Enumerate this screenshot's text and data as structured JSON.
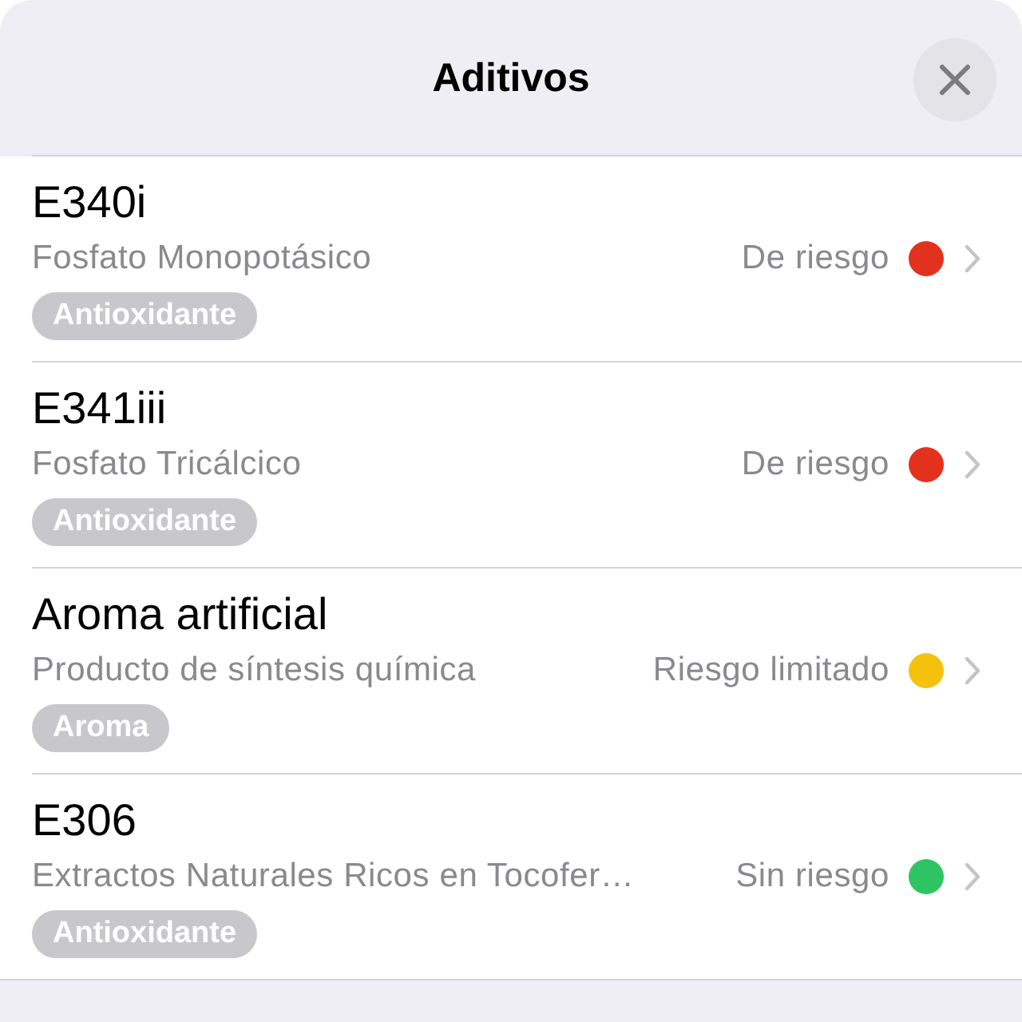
{
  "header": {
    "title": "Aditivos"
  },
  "additives": [
    {
      "name": "E340i",
      "description": "Fosfato Monopotásico",
      "category": "Antioxidante",
      "risk": "De riesgo",
      "color": "#e2311d"
    },
    {
      "name": "E341iii",
      "description": "Fosfato Tricálcico",
      "category": "Antioxidante",
      "risk": "De riesgo",
      "color": "#e2311d"
    },
    {
      "name": "Aroma artificial",
      "description": "Producto de síntesis química",
      "category": "Aroma",
      "risk": "Riesgo limitado",
      "color": "#f4c20d"
    },
    {
      "name": "E306",
      "description": "Extractos Naturales Ricos en Tocofer…",
      "category": "Antioxidante",
      "risk": "Sin riesgo",
      "color": "#2fc463"
    }
  ]
}
